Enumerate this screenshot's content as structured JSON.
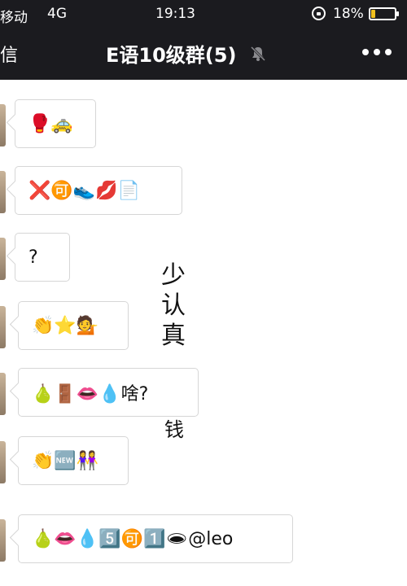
{
  "status_bar": {
    "carrier": "移动",
    "network": "4G",
    "time": "19:13",
    "battery": "18%",
    "battery_level": 0.18
  },
  "nav": {
    "back_label": "信",
    "title": "E语10级群(5)",
    "mute_icon": "mute-bell-icon",
    "more_icon": "more-dots-icon"
  },
  "messages": [
    {
      "content": "🥊🚕"
    },
    {
      "content": "❌🉑👟💋📄"
    },
    {
      "content": "?"
    },
    {
      "content": "👏⭐💁"
    },
    {
      "content": "🍐🚪👄💧啥?"
    },
    {
      "content": "👏🆕👭"
    },
    {
      "content": "🍐👄💧5️⃣🉑1️⃣🕳@leo"
    }
  ],
  "overlay": {
    "vertical_chars": [
      "少",
      "认",
      "真"
    ],
    "tail_char": "钱"
  }
}
